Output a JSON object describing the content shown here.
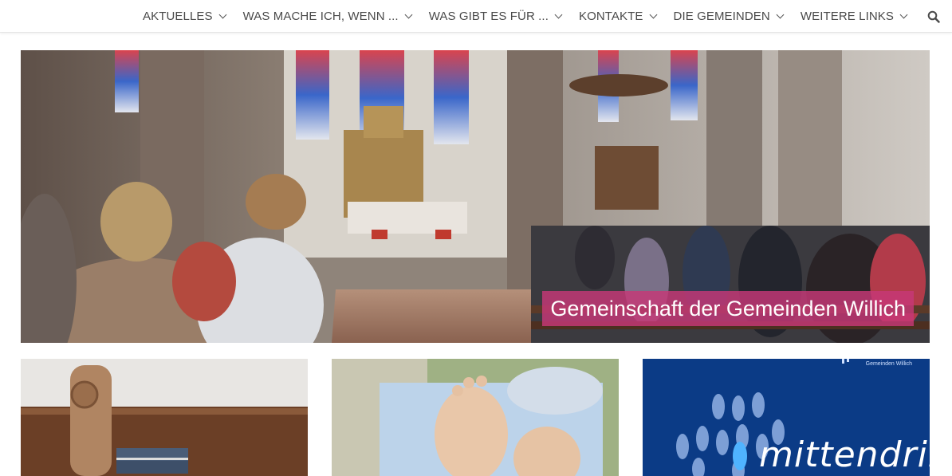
{
  "nav": {
    "items": [
      {
        "label": "AKTUELLES"
      },
      {
        "label": "WAS MACHE ICH, WENN ..."
      },
      {
        "label": "WAS GIBT ES FÜR ..."
      },
      {
        "label": "KONTAKTE"
      },
      {
        "label": "DIE GEMEINDEN"
      },
      {
        "label": "WEITERE LINKS"
      }
    ],
    "search_icon": "search-icon"
  },
  "hero": {
    "caption": "Gemeinschaft der Gemeinden Willich",
    "caption_color": "#c73878"
  },
  "cards": {
    "third": {
      "logo_text": "Gemeinden Willich",
      "brand": "mittendrin",
      "background": "#0b3b86"
    }
  }
}
